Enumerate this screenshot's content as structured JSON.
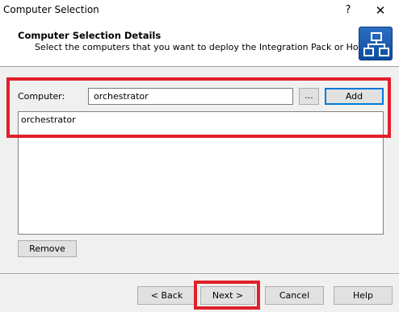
{
  "window": {
    "title": "Computer Selection",
    "help_label": "?",
    "close_label": "✕"
  },
  "header": {
    "title": "Computer Selection Details",
    "subtitle": "Select the computers that you want to deploy the Integration Pack or Hotfix on.",
    "logo_icon": "network-topology-icon"
  },
  "form": {
    "computer_label": "Computer:",
    "computer_value": "orchestrator",
    "browse_label": "...",
    "add_label": "Add",
    "list_items": [
      "orchestrator"
    ],
    "remove_label": "Remove"
  },
  "footer": {
    "back_label": "< Back",
    "next_label": "Next >",
    "cancel_label": "Cancel",
    "help_label": "Help"
  },
  "colors": {
    "highlight": "#e0202a",
    "logo": "#1f63b6"
  }
}
